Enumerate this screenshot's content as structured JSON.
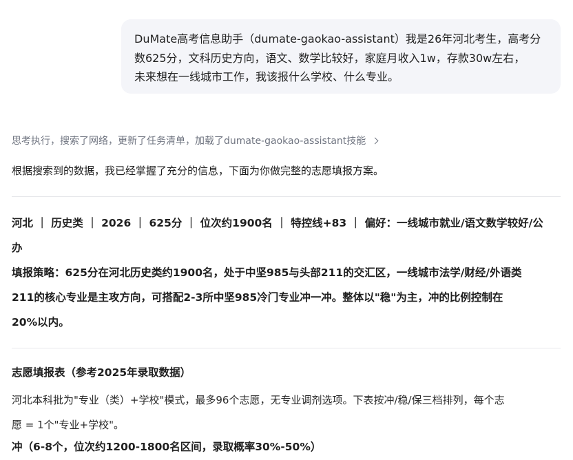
{
  "user_message": {
    "lines": [
      "DuMate高考信息助手（dumate-gaokao-assistant）我是26年河北考生，高考分",
      "数625分，文科历史方向，语文、数学比较好，家庭月收入1w，存款30w左右，",
      "未来想在一线城市工作，我该报什么学校、什么专业。"
    ]
  },
  "assistant": {
    "thinking_summary": "思考执行，搜索了网络，更新了任务清单，加载了dumate-gaokao-assistant技能",
    "thinking_chevron_icon": "chevron-right-icon",
    "intro": "根据搜索到的数据，我已经掌握了充分的信息，下面为你做完整的志愿填报方案。",
    "profile_lines": [
      "河北 ｜ 历史类 ｜ 2026 ｜ 625分 ｜ 位次约1900名 ｜ 特控线+83 ｜ 偏好：一线城市就业/语文数学较好/公",
      "办"
    ],
    "strategy_lines": [
      "填报策略：625分在河北历史类约1900名，处于中坚985与头部211的交汇区，一线城市法学/财经/外语类",
      "211的核心专业是主攻方向，可搭配2-3所中坚985冷门专业冲一冲。整体以\"稳\"为主，冲的比例控制在",
      "20%以内。"
    ],
    "table_section_title": "志愿填报表（参考2025年录取数据）",
    "table_desc_lines": [
      "河北本科批为\"专业（类）+学校\"模式，最多96个志愿，无专业调剂选项。下表按冲/稳/保三档排列，每个志",
      "愿 = 1个\"专业+学校\"。"
    ],
    "tier_chong_title": "冲（6-8个，位次约1200-1800名区间，录取概率30%-50%）"
  }
}
